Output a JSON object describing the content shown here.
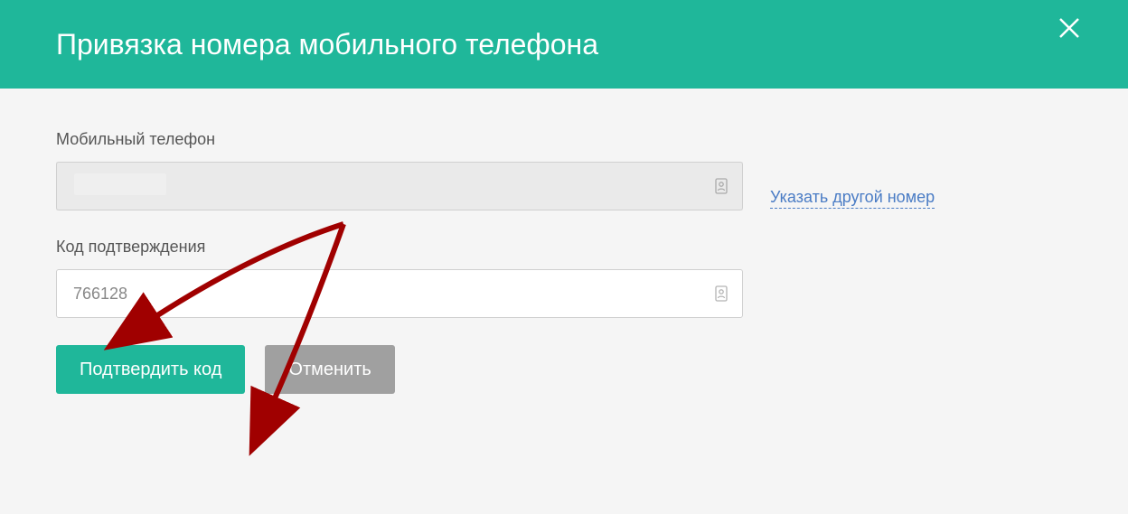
{
  "header": {
    "title": "Привязка номера мобильного телефона"
  },
  "form": {
    "phone": {
      "label": "Мобильный телефон",
      "value": "",
      "link_other": "Указать другой номер"
    },
    "code": {
      "label": "Код подтверждения",
      "value": "766128"
    }
  },
  "buttons": {
    "confirm": "Подтвердить код",
    "cancel": "Отменить"
  },
  "colors": {
    "accent": "#1fb79a",
    "link": "#4a7cc5",
    "secondary": "#a0a0a0"
  }
}
